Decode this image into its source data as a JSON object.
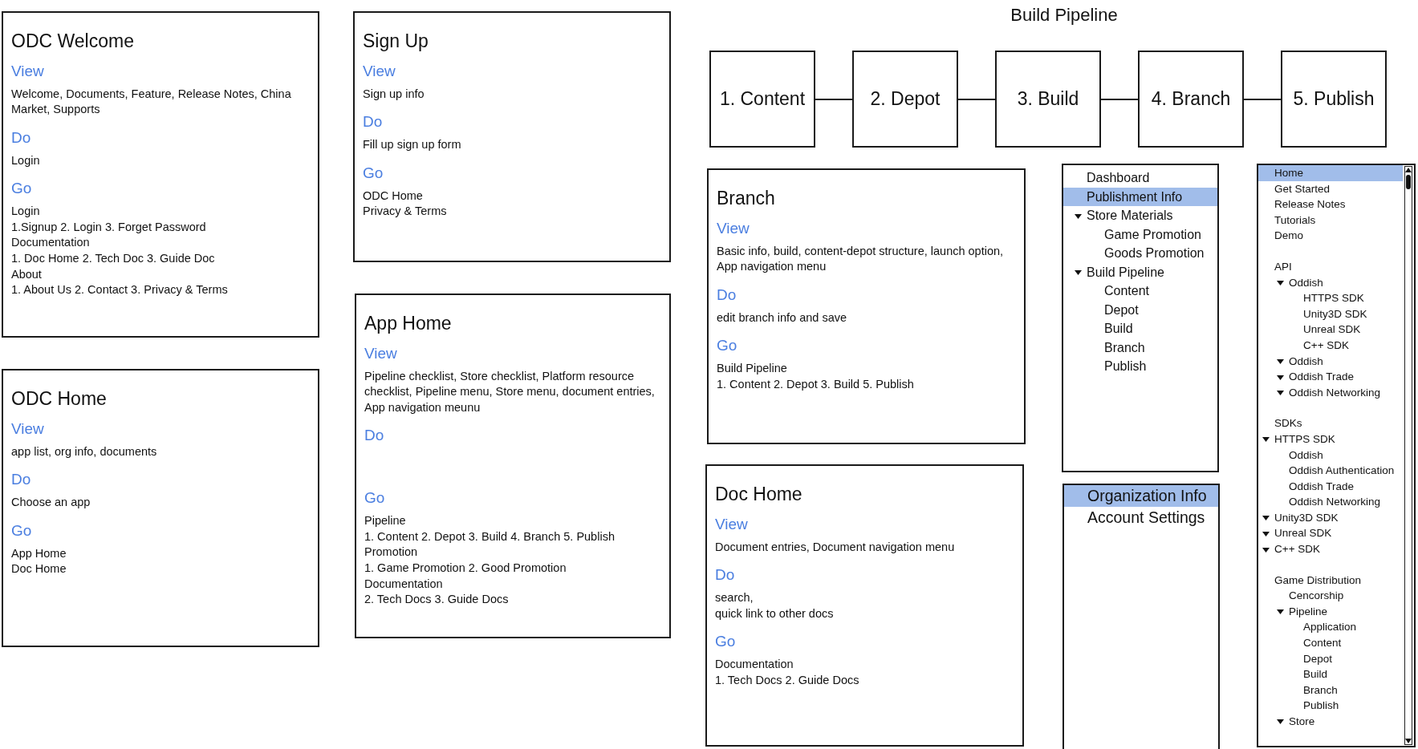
{
  "cards": [
    {
      "title": "ODC Welcome",
      "sections": [
        {
          "label": "View",
          "lines": [
            "Welcome, Documents, Feature, Release Notes, China Market, Supports"
          ]
        },
        {
          "label": "Do",
          "lines": [
            "Login"
          ]
        },
        {
          "label": "Go",
          "lines": [
            "Login",
            "1.Signup 2. Login 3. Forget Password",
            "Documentation",
            "1. Doc Home 2. Tech Doc 3. Guide Doc",
            "About",
            "1. About Us 2. Contact 3. Privacy & Terms"
          ]
        }
      ]
    },
    {
      "title": "ODC Home",
      "sections": [
        {
          "label": "View",
          "lines": [
            "app list, org info, documents"
          ]
        },
        {
          "label": "Do",
          "lines": [
            "Choose an app"
          ]
        },
        {
          "label": "Go",
          "lines": [
            "App Home",
            "Doc Home"
          ]
        }
      ]
    },
    {
      "title": "Sign Up",
      "sections": [
        {
          "label": "View",
          "lines": [
            "Sign up info"
          ]
        },
        {
          "label": "Do",
          "lines": [
            "Fill up sign up form"
          ]
        },
        {
          "label": "Go",
          "lines": [
            "ODC Home",
            "Privacy & Terms"
          ]
        }
      ]
    },
    {
      "title": "App Home",
      "sections": [
        {
          "label": "View",
          "lines": [
            "Pipeline checklist, Store checklist, Platform resource checklist, Pipeline menu, Store menu, document entries, App navigation meunu"
          ]
        },
        {
          "label": "Do"
        },
        {
          "label": "Go",
          "lines": [
            "Pipeline",
            "1. Content 2. Depot 3. Build 4. Branch 5. Publish",
            "Promotion",
            "1. Game Promotion 2. Good Promotion",
            "Documentation",
            "2. Tech Docs 3. Guide Docs"
          ]
        }
      ]
    },
    {
      "title": "Branch",
      "sections": [
        {
          "label": "View",
          "lines": [
            "Basic info, build, content-depot structure, launch option, App navigation menu"
          ]
        },
        {
          "label": "Do",
          "lines": [
            "edit branch info and save"
          ]
        },
        {
          "label": "Go",
          "lines": [
            "Build Pipeline",
            "1. Content 2. Depot 3. Build 5. Publish"
          ]
        }
      ]
    },
    {
      "title": "Doc Home",
      "sections": [
        {
          "label": "View",
          "lines": [
            "Document entries, Document navigation menu"
          ]
        },
        {
          "label": "Do",
          "lines": [
            "search,",
            "quick link to other docs"
          ]
        },
        {
          "label": "Go",
          "lines": [
            "Documentation",
            "1. Tech Docs 2. Guide Docs"
          ]
        }
      ]
    }
  ],
  "pipeline": {
    "title": "Build Pipeline",
    "steps": [
      "1. Content",
      "2. Depot",
      "3. Build",
      "4. Branch",
      "5. Publish"
    ]
  },
  "nav_panels": [
    {
      "items": [
        {
          "label": "Dashboard",
          "selected": false
        },
        {
          "label": "Publishment Info",
          "selected": true
        },
        {
          "label": "Store Materials",
          "selected": false,
          "expanded": true,
          "children": [
            {
              "label": "Game Promotion",
              "selected": false
            },
            {
              "label": "Goods Promotion",
              "selected": false
            }
          ]
        },
        {
          "label": "Build Pipeline",
          "selected": false,
          "expanded": true,
          "children": [
            {
              "label": "Content",
              "selected": false
            },
            {
              "label": "Depot",
              "selected": false
            },
            {
              "label": "Build",
              "selected": false
            },
            {
              "label": "Branch",
              "selected": false
            },
            {
              "label": "Publish",
              "selected": false
            }
          ]
        }
      ]
    },
    {
      "items": [
        {
          "label": "Organization Info",
          "selected": true
        },
        {
          "label": "Account Settings",
          "selected": false
        }
      ]
    }
  ],
  "doc_tree": {
    "groups": [
      {
        "items": [
          {
            "label": "Home",
            "selected": true
          },
          {
            "label": "Get Started",
            "selected": false
          },
          {
            "label": "Release Notes",
            "selected": false
          },
          {
            "label": "Tutorials",
            "selected": false
          },
          {
            "label": "Demo",
            "selected": false
          }
        ]
      },
      {
        "items": [
          {
            "label": "API",
            "selected": false,
            "children": [
              {
                "label": "Oddish",
                "selected": false,
                "expanded": true,
                "children": [
                  {
                    "label": "HTTPS SDK",
                    "selected": false
                  },
                  {
                    "label": "Unity3D SDK",
                    "selected": false
                  },
                  {
                    "label": "Unreal SDK",
                    "selected": false
                  },
                  {
                    "label": "C++ SDK",
                    "selected": false
                  }
                ]
              },
              {
                "label": "Oddish",
                "selected": false,
                "expanded": true
              },
              {
                "label": "Oddish Trade",
                "selected": false,
                "expanded": true
              },
              {
                "label": "Oddish Networking",
                "selected": false,
                "expanded": true
              }
            ]
          }
        ]
      },
      {
        "items": [
          {
            "label": "SDKs",
            "selected": false
          },
          {
            "label": "HTTPS SDK",
            "selected": false,
            "expanded": true,
            "children": [
              {
                "label": "Oddish",
                "selected": false
              },
              {
                "label": "Oddish Authentication",
                "selected": false
              },
              {
                "label": "Oddish Trade",
                "selected": false
              },
              {
                "label": "Oddish Networking",
                "selected": false
              }
            ]
          },
          {
            "label": "Unity3D SDK",
            "selected": false,
            "expanded": true
          },
          {
            "label": "Unreal SDK",
            "selected": false,
            "expanded": true
          },
          {
            "label": "C++ SDK",
            "selected": false,
            "expanded": true
          }
        ]
      },
      {
        "items": [
          {
            "label": "Game Distribution",
            "selected": false,
            "children": [
              {
                "label": "Cencorship",
                "selected": false
              },
              {
                "label": "Pipeline",
                "selected": false,
                "expanded": true,
                "children": [
                  {
                    "label": "Application",
                    "selected": false
                  },
                  {
                    "label": "Content",
                    "selected": false
                  },
                  {
                    "label": "Depot",
                    "selected": false
                  },
                  {
                    "label": "Build",
                    "selected": false
                  },
                  {
                    "label": "Branch",
                    "selected": false
                  },
                  {
                    "label": "Publish",
                    "selected": false
                  }
                ]
              },
              {
                "label": "Store",
                "selected": false,
                "expanded": true
              }
            ]
          }
        ]
      }
    ]
  }
}
